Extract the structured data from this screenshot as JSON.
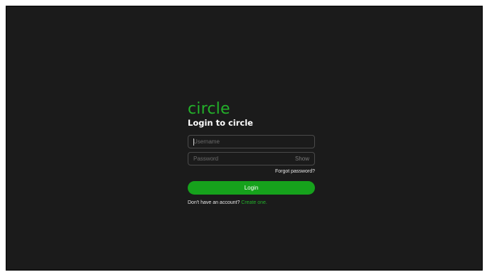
{
  "brand": {
    "logo_text": "circle",
    "accent_color": "#23b02a"
  },
  "login_form": {
    "heading": "Login to circle",
    "username": {
      "value": "",
      "placeholder": "Username"
    },
    "password": {
      "value": "",
      "placeholder": "Password",
      "toggle_label": "Show"
    },
    "forgot_password_link": "Forgot password?",
    "submit_label": "Login",
    "submit_color": "#16a21c",
    "signup_prompt": "Don't have an account?",
    "signup_link": "Create one."
  }
}
